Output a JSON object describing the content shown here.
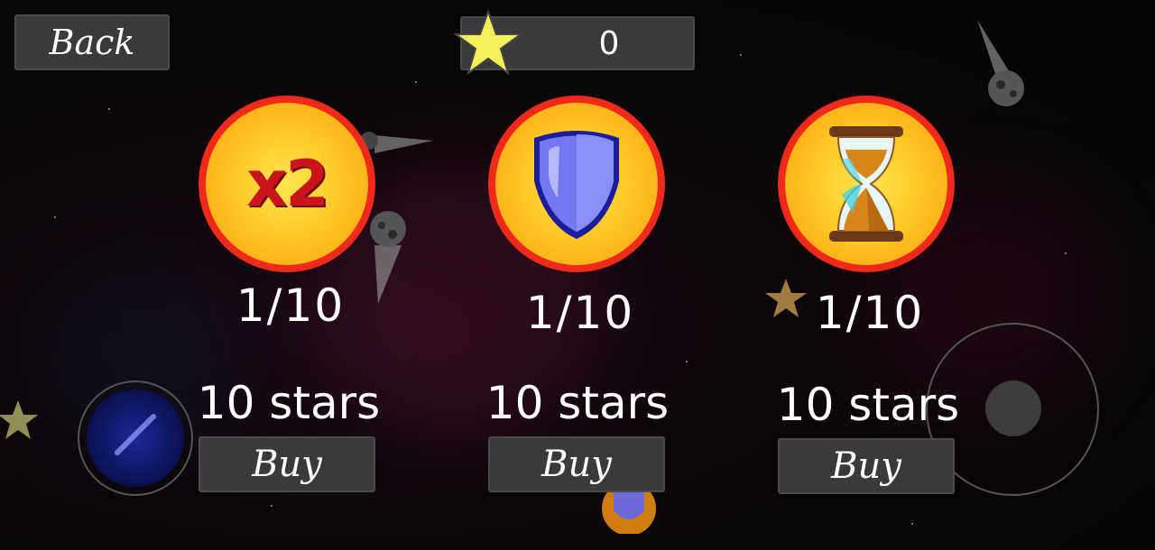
{
  "top_bar": {
    "back_label": "Back",
    "star_count": "0"
  },
  "shop_items": [
    {
      "icon": "x2-multiplier-icon",
      "icon_text": "x2",
      "level": "1/10",
      "price": "10 stars",
      "buy_label": "Buy"
    },
    {
      "icon": "shield-icon",
      "level": "1/10",
      "price": "10 stars",
      "buy_label": "Buy"
    },
    {
      "icon": "hourglass-icon",
      "level": "1/10",
      "price": "10 stars",
      "buy_label": "Buy"
    }
  ],
  "colors": {
    "button_bg": "#3a3a3a",
    "circle_border": "#f02a1a",
    "circle_fill": "#ffc220",
    "star": "#f5f05a"
  }
}
